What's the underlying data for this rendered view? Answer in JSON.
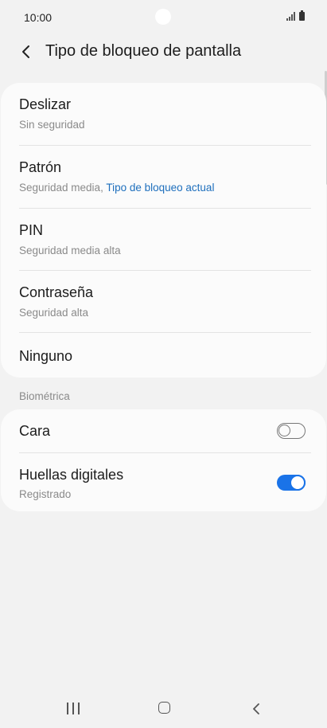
{
  "status_bar": {
    "time": "10:00",
    "icons": [
      "signal-icon",
      "battery-icon"
    ]
  },
  "header": {
    "back_icon": "chevron-left-icon",
    "title": "Tipo de bloqueo de pantalla"
  },
  "lock_types": [
    {
      "title": "Deslizar",
      "subtitle": "Sin seguridad"
    },
    {
      "title": "Patrón",
      "subtitle": "Seguridad media,",
      "subtitle_accent": "Tipo de bloqueo actual"
    },
    {
      "title": "PIN",
      "subtitle": "Seguridad media alta"
    },
    {
      "title": "Contraseña",
      "subtitle": "Seguridad alta"
    },
    {
      "title": "Ninguno"
    }
  ],
  "biometrics": {
    "section_label": "Biométrica",
    "items": [
      {
        "title": "Cara",
        "toggle_on": false
      },
      {
        "title": "Huellas digitales",
        "subtitle": "Registrado",
        "toggle_on": true
      }
    ]
  },
  "colors": {
    "accent": "#1a73e8",
    "link": "#1e6fbd",
    "background": "#f2f2f2",
    "card": "#fbfbfb"
  },
  "nav_bar": {
    "icons": [
      "recent-apps-icon",
      "home-icon",
      "back-icon"
    ]
  }
}
